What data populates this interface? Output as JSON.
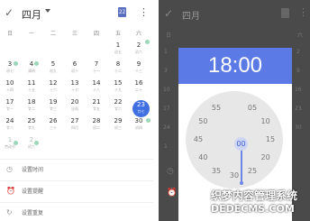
{
  "header": {
    "check_icon": "checkmark",
    "month": "四月",
    "calendar_icon_text": "22",
    "more_icon": "more-vert"
  },
  "weekdays": [
    "日",
    "一",
    "二",
    "三",
    "四",
    "五",
    "六"
  ],
  "days": [
    {
      "n": "1",
      "s": "初五"
    },
    {
      "n": "2",
      "s": "初六"
    },
    {
      "n": "3",
      "s": "初七"
    },
    {
      "n": "4",
      "s": "清明"
    },
    {
      "n": "5",
      "s": "初九"
    },
    {
      "n": "6",
      "s": "初十"
    },
    {
      "n": "7",
      "s": "十一"
    },
    {
      "n": "8",
      "s": "十二"
    },
    {
      "n": "9",
      "s": "十三"
    },
    {
      "n": "10",
      "s": "十四"
    },
    {
      "n": "11",
      "s": "十五"
    },
    {
      "n": "12",
      "s": "十六"
    },
    {
      "n": "13",
      "s": "十七"
    },
    {
      "n": "14",
      "s": "十八"
    },
    {
      "n": "15",
      "s": "十九"
    },
    {
      "n": "16",
      "s": "二十"
    },
    {
      "n": "17",
      "s": "廿一"
    },
    {
      "n": "18",
      "s": "廿二"
    },
    {
      "n": "19",
      "s": "廿三"
    },
    {
      "n": "20",
      "s": "谷雨"
    },
    {
      "n": "21",
      "s": "廿五"
    },
    {
      "n": "22",
      "s": "廿六"
    },
    {
      "n": "23",
      "s": "廿七"
    },
    {
      "n": "24",
      "s": "廿八"
    },
    {
      "n": "25",
      "s": "廿九"
    },
    {
      "n": "26",
      "s": "三十"
    },
    {
      "n": "27",
      "s": "四月"
    },
    {
      "n": "28",
      "s": "初二"
    },
    {
      "n": "29",
      "s": "初三"
    },
    {
      "n": "30",
      "s": "初四"
    },
    {
      "n": "1",
      "s": "劳动节"
    },
    {
      "n": "2",
      "s": "初六"
    }
  ],
  "selected_day": "23",
  "options": [
    {
      "icon": "clock-icon",
      "label": "设置时间"
    },
    {
      "icon": "alarm-icon",
      "label": "设置提醒"
    },
    {
      "icon": "repeat-icon",
      "label": "设置重复"
    }
  ],
  "dialog": {
    "time": "18:00",
    "dial": [
      "00",
      "05",
      "10",
      "15",
      "20",
      "25",
      "30",
      "35",
      "40",
      "45",
      "50",
      "55"
    ],
    "selected": "00"
  },
  "right_bar": {
    "month": "四月"
  },
  "watermark": {
    "line1": "织梦内容管理系统",
    "line2": "DEDECMS.COM"
  }
}
